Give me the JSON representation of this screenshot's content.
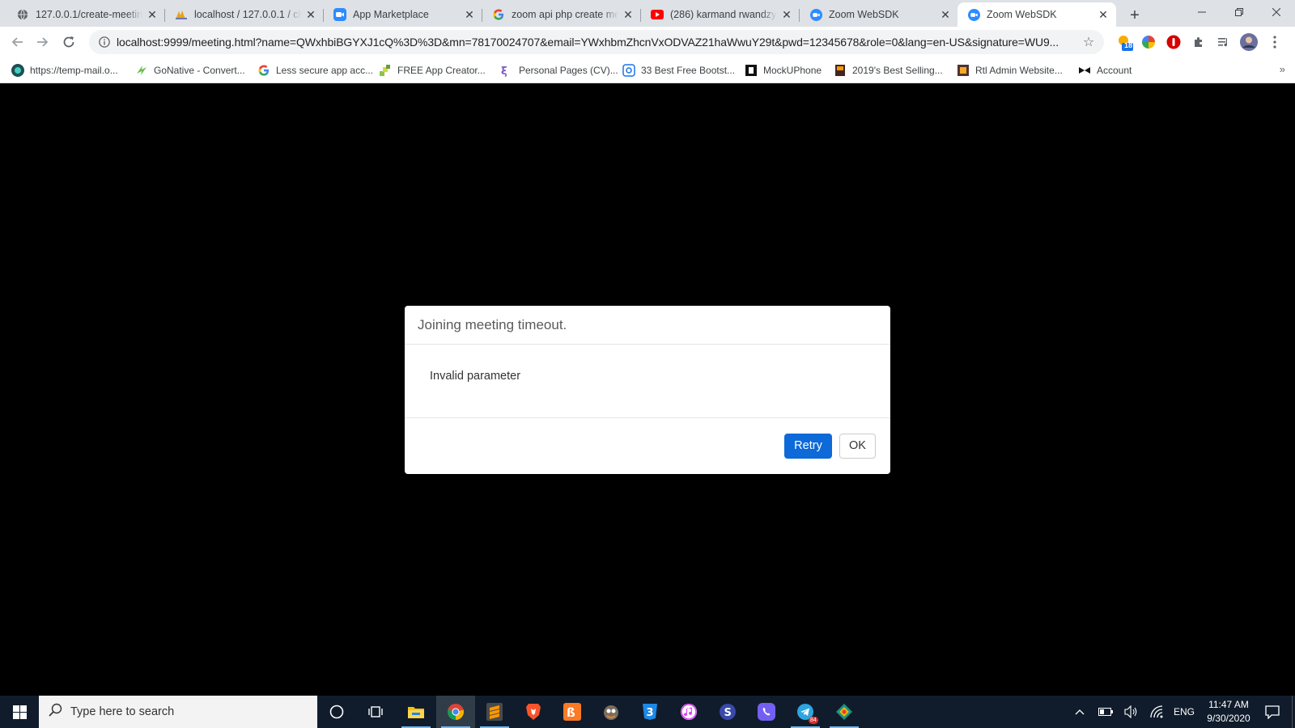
{
  "browser": {
    "tabs": [
      {
        "title": "127.0.0.1/create-meeting",
        "icon": "globe-icon",
        "active": false
      },
      {
        "title": "localhost / 127.0.0.1 / ch",
        "icon": "phpmyadmin-icon",
        "active": false
      },
      {
        "title": "App Marketplace",
        "icon": "zoom-icon",
        "active": false
      },
      {
        "title": "zoom api php create me",
        "icon": "google-icon",
        "active": false
      },
      {
        "title": "(286) karmand rwandzy",
        "icon": "youtube-icon",
        "active": false
      },
      {
        "title": "Zoom WebSDK",
        "icon": "zoom-circle-icon",
        "active": false
      },
      {
        "title": "Zoom WebSDK",
        "icon": "zoom-circle-icon",
        "active": true
      }
    ],
    "address": "localhost:9999/meeting.html?name=QWxhbiBGYXJ1cQ%3D%3D&mn=78170024707&email=YWxhbmZhcnVxODVAZ21haWwuY29t&pwd=12345678&role=0&lang=en-US&signature=WU9...",
    "extension_badge": "18",
    "bookmarks": [
      {
        "label": "https://temp-mail.o...",
        "icon": "tempmail-icon"
      },
      {
        "label": "GoNative - Convert...",
        "icon": "gonative-icon"
      },
      {
        "label": "Less secure app acc...",
        "icon": "google-icon"
      },
      {
        "label": "FREE App Creator...",
        "icon": "appcreator-icon"
      },
      {
        "label": "Personal Pages (CV)...",
        "icon": "personal-pages-icon"
      },
      {
        "label": "33 Best Free Bootst...",
        "icon": "bootstrap-icon"
      },
      {
        "label": "MockUPhone",
        "icon": "mockuphone-icon"
      },
      {
        "label": "2019's Best Selling...",
        "icon": "bestselling-icon"
      },
      {
        "label": "Rtl Admin Website...",
        "icon": "rtladmin-icon"
      },
      {
        "label": "Account",
        "icon": "account-icon"
      }
    ],
    "bookmarks_more": "»"
  },
  "dialog": {
    "title": "Joining meeting timeout.",
    "message": "Invalid parameter",
    "retry_label": "Retry",
    "ok_label": "OK"
  },
  "taskbar": {
    "search_placeholder": "Type here to search",
    "language": "ENG",
    "time": "11:47 AM",
    "date": "9/30/2020",
    "telegram_badge": "84"
  },
  "colors": {
    "primary_button": "#0d6ad8",
    "taskbar": "#101c2c",
    "tabstrip": "#dee1e6"
  }
}
